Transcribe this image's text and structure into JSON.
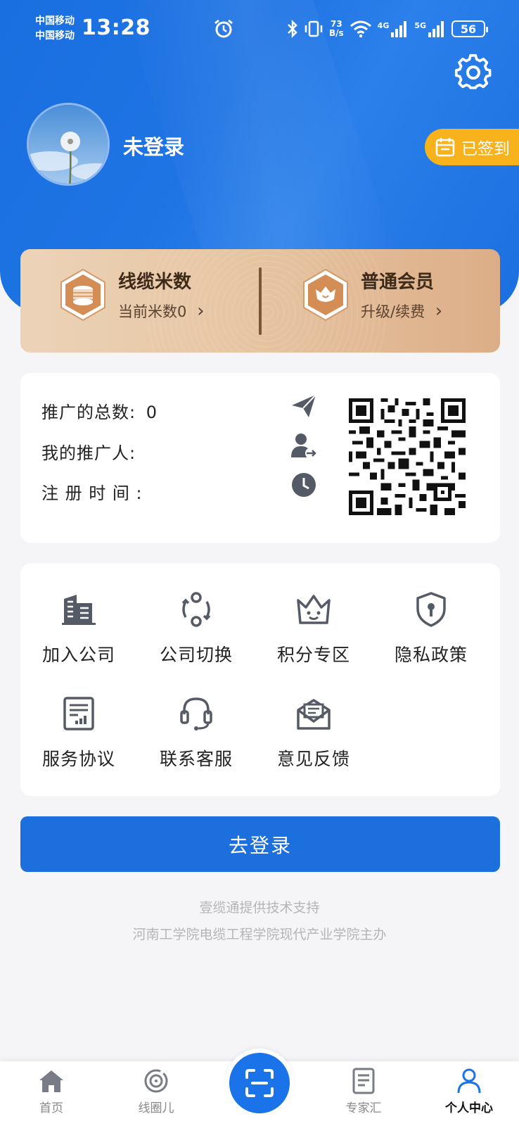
{
  "status_bar": {
    "carrier_1": "中国移动",
    "carrier_2": "中国移动",
    "time": "13:28",
    "net_speed_value": "73",
    "net_speed_unit": "B/s",
    "sim1_type": "4G",
    "sim2_type": "5G",
    "battery": "56"
  },
  "profile": {
    "username": "未登录",
    "checkin_label": "已签到"
  },
  "membership": {
    "cable": {
      "title": "线缆米数",
      "subtitle": "当前米数0",
      "chevron": "›"
    },
    "member": {
      "title": "普通会员",
      "subtitle": "升级/续费",
      "chevron": "›"
    }
  },
  "promotion": {
    "total_label": "推广的总数:",
    "total_value": "0",
    "promoter_label": "我的推广人:",
    "register_time_label": "注 册 时 间 :"
  },
  "menu": [
    {
      "label": "加入公司",
      "icon": "building-icon"
    },
    {
      "label": "公司切换",
      "icon": "switch-icon"
    },
    {
      "label": "积分专区",
      "icon": "crown-icon"
    },
    {
      "label": "隐私政策",
      "icon": "shield-icon"
    },
    {
      "label": "服务协议",
      "icon": "document-chart-icon"
    },
    {
      "label": "联系客服",
      "icon": "headset-icon"
    },
    {
      "label": "意见反馈",
      "icon": "mail-icon"
    }
  ],
  "login_button": "去登录",
  "footer": {
    "line1": "壹缆通提供技术支持",
    "line2": "河南工学院电缆工程学院现代产业学院主办"
  },
  "tabs": [
    {
      "label": "首页",
      "icon": "home-icon"
    },
    {
      "label": "线圈儿",
      "icon": "coil-icon"
    },
    {
      "label": "专家汇",
      "icon": "article-icon"
    },
    {
      "label": "个人中心",
      "icon": "person-icon",
      "active": true
    }
  ],
  "colors": {
    "primary": "#1c6fdd",
    "checkin": "#f7b21c",
    "gold_start": "#ecd3b8",
    "gold_end": "#dcae88"
  }
}
